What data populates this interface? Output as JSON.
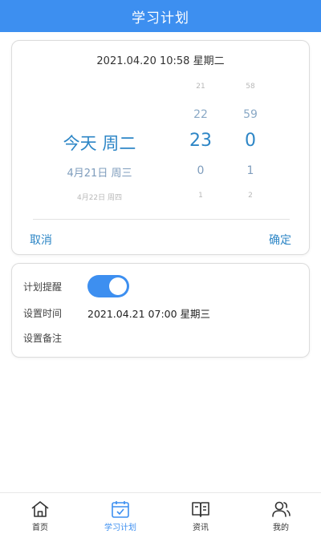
{
  "header": {
    "title": "学习计划"
  },
  "picker": {
    "current_datetime": "2021.04.20 10:58 星期二",
    "date_column": [
      "",
      "",
      "今天 周二",
      "4月21日 周三",
      "4月22日 周四"
    ],
    "hour_column": [
      "21",
      "22",
      "23",
      "0",
      "1"
    ],
    "minute_column": [
      "58",
      "59",
      "0",
      "1",
      "2"
    ],
    "cancel_label": "取消",
    "confirm_label": "确定"
  },
  "settings": {
    "reminder_label": "计划提醒",
    "reminder_enabled": true,
    "time_label": "设置时间",
    "time_value": "2021.04.21 07:00 星期三",
    "note_label": "设置备注"
  },
  "tabs": [
    {
      "label": "首页",
      "icon": "home-icon"
    },
    {
      "label": "学习计划",
      "icon": "calendar-icon",
      "active": true
    },
    {
      "label": "资讯",
      "icon": "book-icon"
    },
    {
      "label": "我的",
      "icon": "user-icon"
    }
  ],
  "colors": {
    "accent": "#3d8ff0",
    "picker_text": "#2d86c6"
  }
}
